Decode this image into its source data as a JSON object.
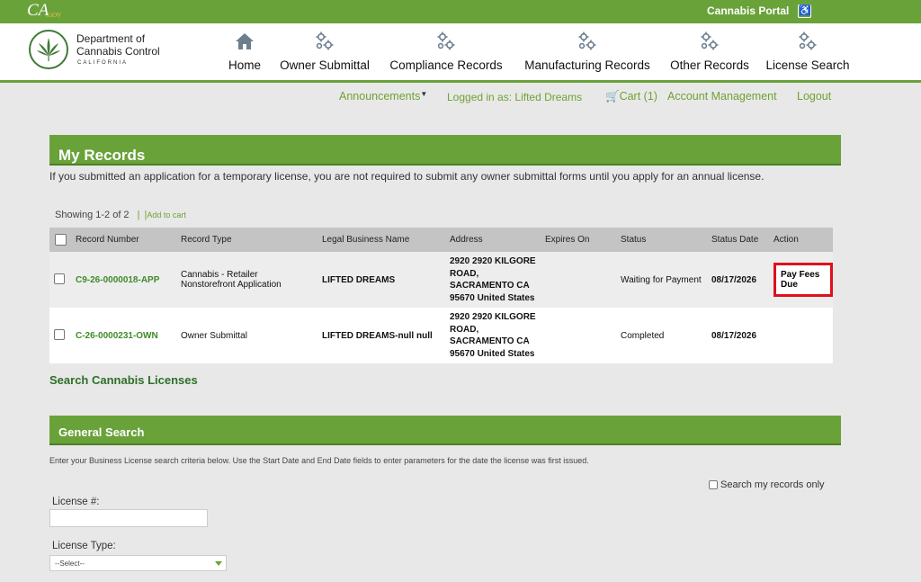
{
  "topbar": {
    "logo_main": "CA",
    "logo_sub": ".GOV",
    "portal_title": "Cannabis Portal"
  },
  "agency": {
    "name_line1": "Department of",
    "name_line2": "Cannabis Control",
    "state": "CALIFORNIA"
  },
  "nav": [
    {
      "label": "Home",
      "icon": "home-icon"
    },
    {
      "label": "Owner Submittal",
      "icon": "gears-icon"
    },
    {
      "label": "Compliance Records",
      "icon": "gears-icon"
    },
    {
      "label": "Manufacturing Records",
      "icon": "gears-icon"
    },
    {
      "label": "Other Records",
      "icon": "gears-icon"
    },
    {
      "label": "License Search",
      "icon": "gears-icon"
    }
  ],
  "subnav": {
    "announcements": "Announcements",
    "logged_in": "Logged in as: Lifted Dreams",
    "cart": "Cart (1)",
    "account": "Account Management",
    "logout": "Logout"
  },
  "my_records": {
    "title": "My Records",
    "note": "If you submitted an application for a temporary license, you are not required to submit any owner submittal forms until you apply for an annual license.",
    "showing": "Showing 1-2 of 2",
    "add_to_cart": "Add to cart",
    "columns": [
      "Record Number",
      "Record Type",
      "Legal Business Name",
      "Address",
      "Expires On",
      "Status",
      "Status Date",
      "Action"
    ],
    "rows": [
      {
        "record_number": "C9-26-0000018-APP",
        "record_type_1": "Cannabis - Retailer",
        "record_type_2": "Nonstorefront Application",
        "business": "LIFTED DREAMS",
        "addr_1": "2920 2920 KILGORE",
        "addr_2": "ROAD,",
        "addr_3": "SACRAMENTO CA",
        "addr_4": "95670 United States",
        "expires": "",
        "status": "Waiting for Payment",
        "status_date": "08/17/2026",
        "action": "Pay Fees Due"
      },
      {
        "record_number": "C-26-0000231-OWN",
        "record_type_1": "Owner Submittal",
        "record_type_2": "",
        "business": "LIFTED DREAMS-null null",
        "addr_1": "2920 2920 KILGORE",
        "addr_2": "ROAD,",
        "addr_3": "SACRAMENTO CA",
        "addr_4": "95670 United States",
        "expires": "",
        "status": "Completed",
        "status_date": "08/17/2026",
        "action": ""
      }
    ]
  },
  "search_link": "Search Cannabis Licenses",
  "general_search": {
    "title": "General Search",
    "description": "Enter your Business License search criteria below.  Use the Start Date and End Date fields to enter parameters for the date the license was first issued.",
    "my_records_only": "Search my records only",
    "license_label": "License #:",
    "license_value": "",
    "license_type_label": "License Type:",
    "license_type_selected": "--Select--"
  },
  "colors": {
    "brand_green": "#6aa23a",
    "link_green": "#6ea235",
    "alert_red": "#e0101a"
  }
}
